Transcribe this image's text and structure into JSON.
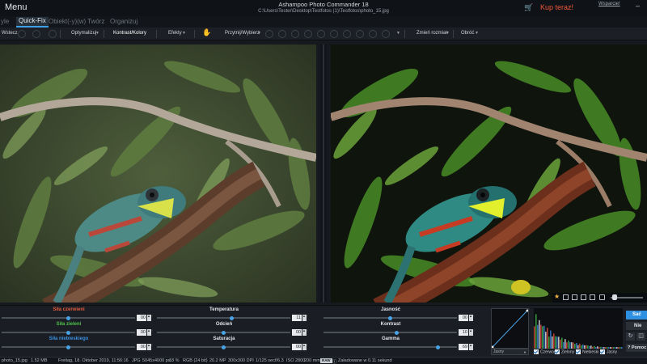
{
  "window": {
    "menu_label": "Menu",
    "app_title": "Ashampoo Photo Commander 18",
    "file_path": "C:\\Users\\Tester\\Desktop\\Testfotos (1)\\Testfotos\\photo_15.jpg",
    "buy_now": "Kup teraz!",
    "support_link": "Wsparcie!",
    "cart_icon": "cart-icon"
  },
  "tabs": [
    {
      "label": "yle"
    },
    {
      "label": "Quick-Fix",
      "active": true
    },
    {
      "label": "Obiekt(-y)(w)"
    },
    {
      "label": "Twórz"
    },
    {
      "label": "Organizuj"
    }
  ],
  "toolbar": {
    "first_label": "Wstecz",
    "optimize": "Optymalizuj",
    "contrast_colors": "Kontrast/Kolory",
    "effects": "Efekty",
    "crop_select": "Przytnij/Wybierz",
    "resize": "Zmień rozmiar",
    "rotate": "Obróć"
  },
  "adjust": {
    "columns": [
      {
        "rows": [
          {
            "label": "Siła czerwieni",
            "color": "#e25a3c",
            "value": "00",
            "level": 0.5
          },
          {
            "label": "Siła zieleni",
            "color": "#4fc04a",
            "value": "00",
            "level": 0.5
          },
          {
            "label": "Siła niebieskiego",
            "color": "#3b8fe0",
            "value": "00",
            "level": 0.5
          }
        ]
      },
      {
        "rows": [
          {
            "label": "Temperatura",
            "color": "#e1e4e8",
            "value": "11",
            "level": 0.56
          },
          {
            "label": "Odcień",
            "color": "#e1e4e8",
            "value": "00",
            "level": 0.5
          },
          {
            "label": "Saturacja",
            "color": "#e1e4e8",
            "value": "00",
            "level": 0.5
          }
        ]
      },
      {
        "rows": [
          {
            "label": "Jasność",
            "color": "#e1e4e8",
            "value": "00",
            "level": 0.5
          },
          {
            "label": "Kontrast",
            "color": "#e1e4e8",
            "value": "10",
            "level": 0.55
          },
          {
            "label": "Gamma",
            "color": "#e1e4e8",
            "value": "69",
            "level": 0.86
          }
        ]
      }
    ],
    "curve_channel": "Jasny",
    "checkboxes": [
      "Czerwony",
      "Zielony",
      "Niebieski",
      "Jasny"
    ],
    "save": "Sać",
    "no": "Nie",
    "help": "Pomoc"
  },
  "status": {
    "filename": "photo_15.jpg",
    "filesize": "1.52 MB",
    "date": "Freitag, 18. Oktober 2019, 11:56:16",
    "format": "JPG",
    "dimensions": "5045x4000 px",
    "zoom": "18 %",
    "color_mode": "RGB (24 bit)",
    "megapixels": "20.2 MP",
    "dpi": "300x300 DPI",
    "exposure": "1/125 sec",
    "aperture": "f/6.3",
    "iso": "ISO 2800",
    "focal": "200 mm",
    "badge": "RAW",
    "loaded": "Załadowane w 0.11 sekund"
  }
}
